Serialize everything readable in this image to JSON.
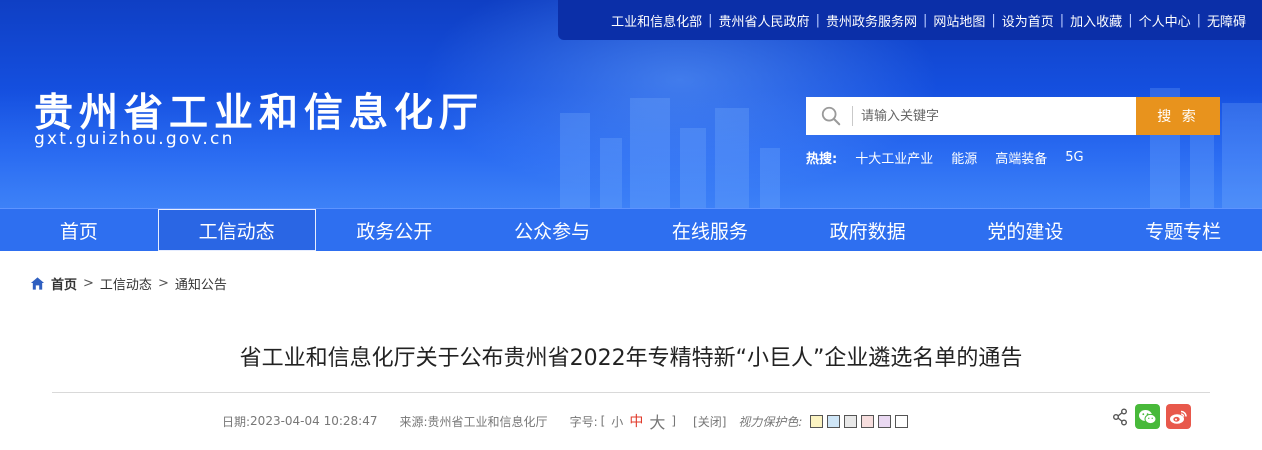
{
  "top_links": [
    "工业和信息化部",
    "贵州省人民政府",
    "贵州政务服务网",
    "网站地图",
    "设为首页",
    "加入收藏",
    "个人中心",
    "无障碍"
  ],
  "site": {
    "title": "贵州省工业和信息化厅",
    "domain": "gxt.guizhou.gov.cn"
  },
  "search": {
    "placeholder": "请输入关键字",
    "button": "搜 索"
  },
  "hot": {
    "label": "热搜:",
    "items": [
      "十大工业产业",
      "能源",
      "高端装备",
      "5G"
    ]
  },
  "nav": [
    "首页",
    "工信动态",
    "政务公开",
    "公众参与",
    "在线服务",
    "政府数据",
    "党的建设",
    "专题专栏"
  ],
  "breadcrumb": {
    "home": "首页",
    "sep": ">",
    "section": "工信动态",
    "current": "通知公告"
  },
  "article": {
    "title": "省工业和信息化厅关于公布贵州省2022年专精特新“小巨人”企业遴选名单的通告",
    "date_label": "日期:",
    "date": "2023-04-04 10:28:47",
    "source_label": "来源:",
    "source": "贵州省工业和信息化厅",
    "font_label": "字号:",
    "font_open": "[",
    "font_small": "小",
    "font_medium": "中",
    "font_large": "大",
    "font_close": "]",
    "close": "[关闭]",
    "vision_label": "视力保护色:"
  },
  "colors": {
    "banner": "#1550e0",
    "nav": "#2e6ff0",
    "search_button": "#e8931d",
    "swatches": [
      "#fbf3c2",
      "#cfe6f7",
      "#e8e8e8",
      "#f7dede",
      "#ead9f2",
      "#ffffff"
    ]
  }
}
